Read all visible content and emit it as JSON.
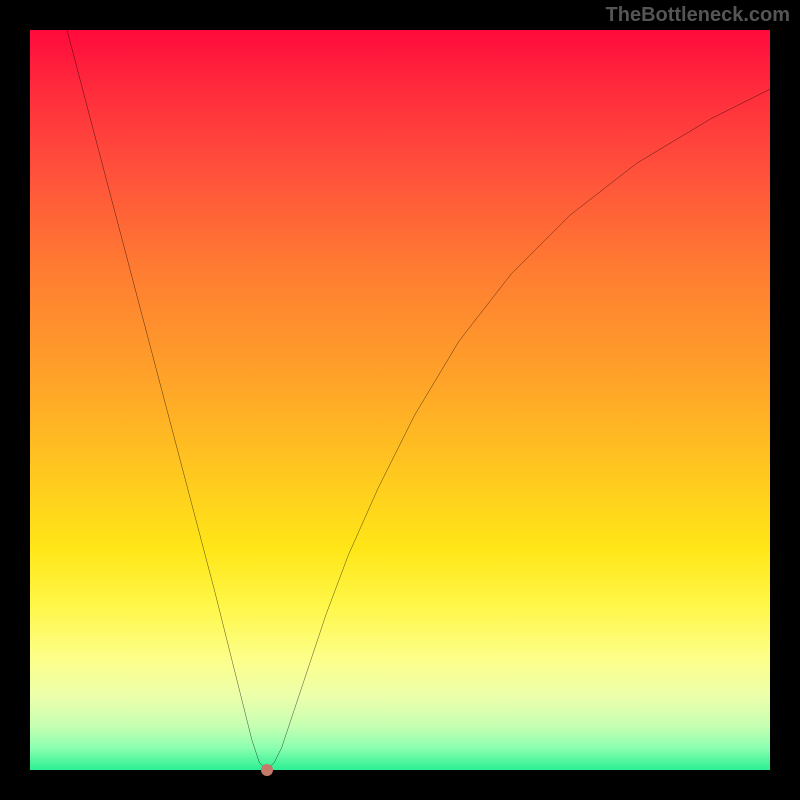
{
  "watermark": "TheBottleneck.com",
  "chart_data": {
    "type": "line",
    "title": "",
    "xlabel": "",
    "ylabel": "",
    "xlim": [
      0,
      100
    ],
    "ylim": [
      0,
      100
    ],
    "series": [
      {
        "name": "curve",
        "x": [
          5,
          10,
          15,
          20,
          25,
          27,
          29,
          30,
          31,
          32,
          33,
          34,
          35,
          37,
          40,
          43,
          47,
          52,
          58,
          65,
          73,
          82,
          92,
          100
        ],
        "y": [
          100,
          81,
          62,
          43,
          24,
          16,
          8,
          4,
          1,
          0,
          1,
          3,
          6,
          12,
          21,
          29,
          38,
          48,
          58,
          67,
          75,
          82,
          88,
          92
        ]
      }
    ],
    "marker": {
      "x": 32,
      "y": 0,
      "color": "#c47a6a"
    },
    "background_gradient": {
      "top": "#ff0a3c",
      "mid_upper": "#ffa528",
      "mid_lower": "#fff74a",
      "bottom": "#2bef93"
    }
  }
}
